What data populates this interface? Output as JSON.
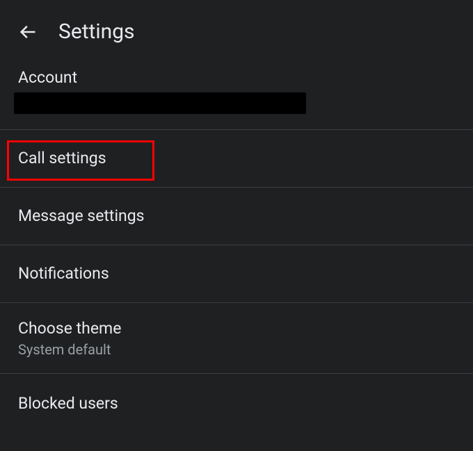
{
  "header": {
    "title": "Settings"
  },
  "items": {
    "account": {
      "label": "Account"
    },
    "call_settings": {
      "label": "Call settings"
    },
    "message_settings": {
      "label": "Message settings"
    },
    "notifications": {
      "label": "Notifications"
    },
    "theme": {
      "label": "Choose theme",
      "subtitle": "System default"
    },
    "blocked_users": {
      "label": "Blocked users"
    }
  }
}
